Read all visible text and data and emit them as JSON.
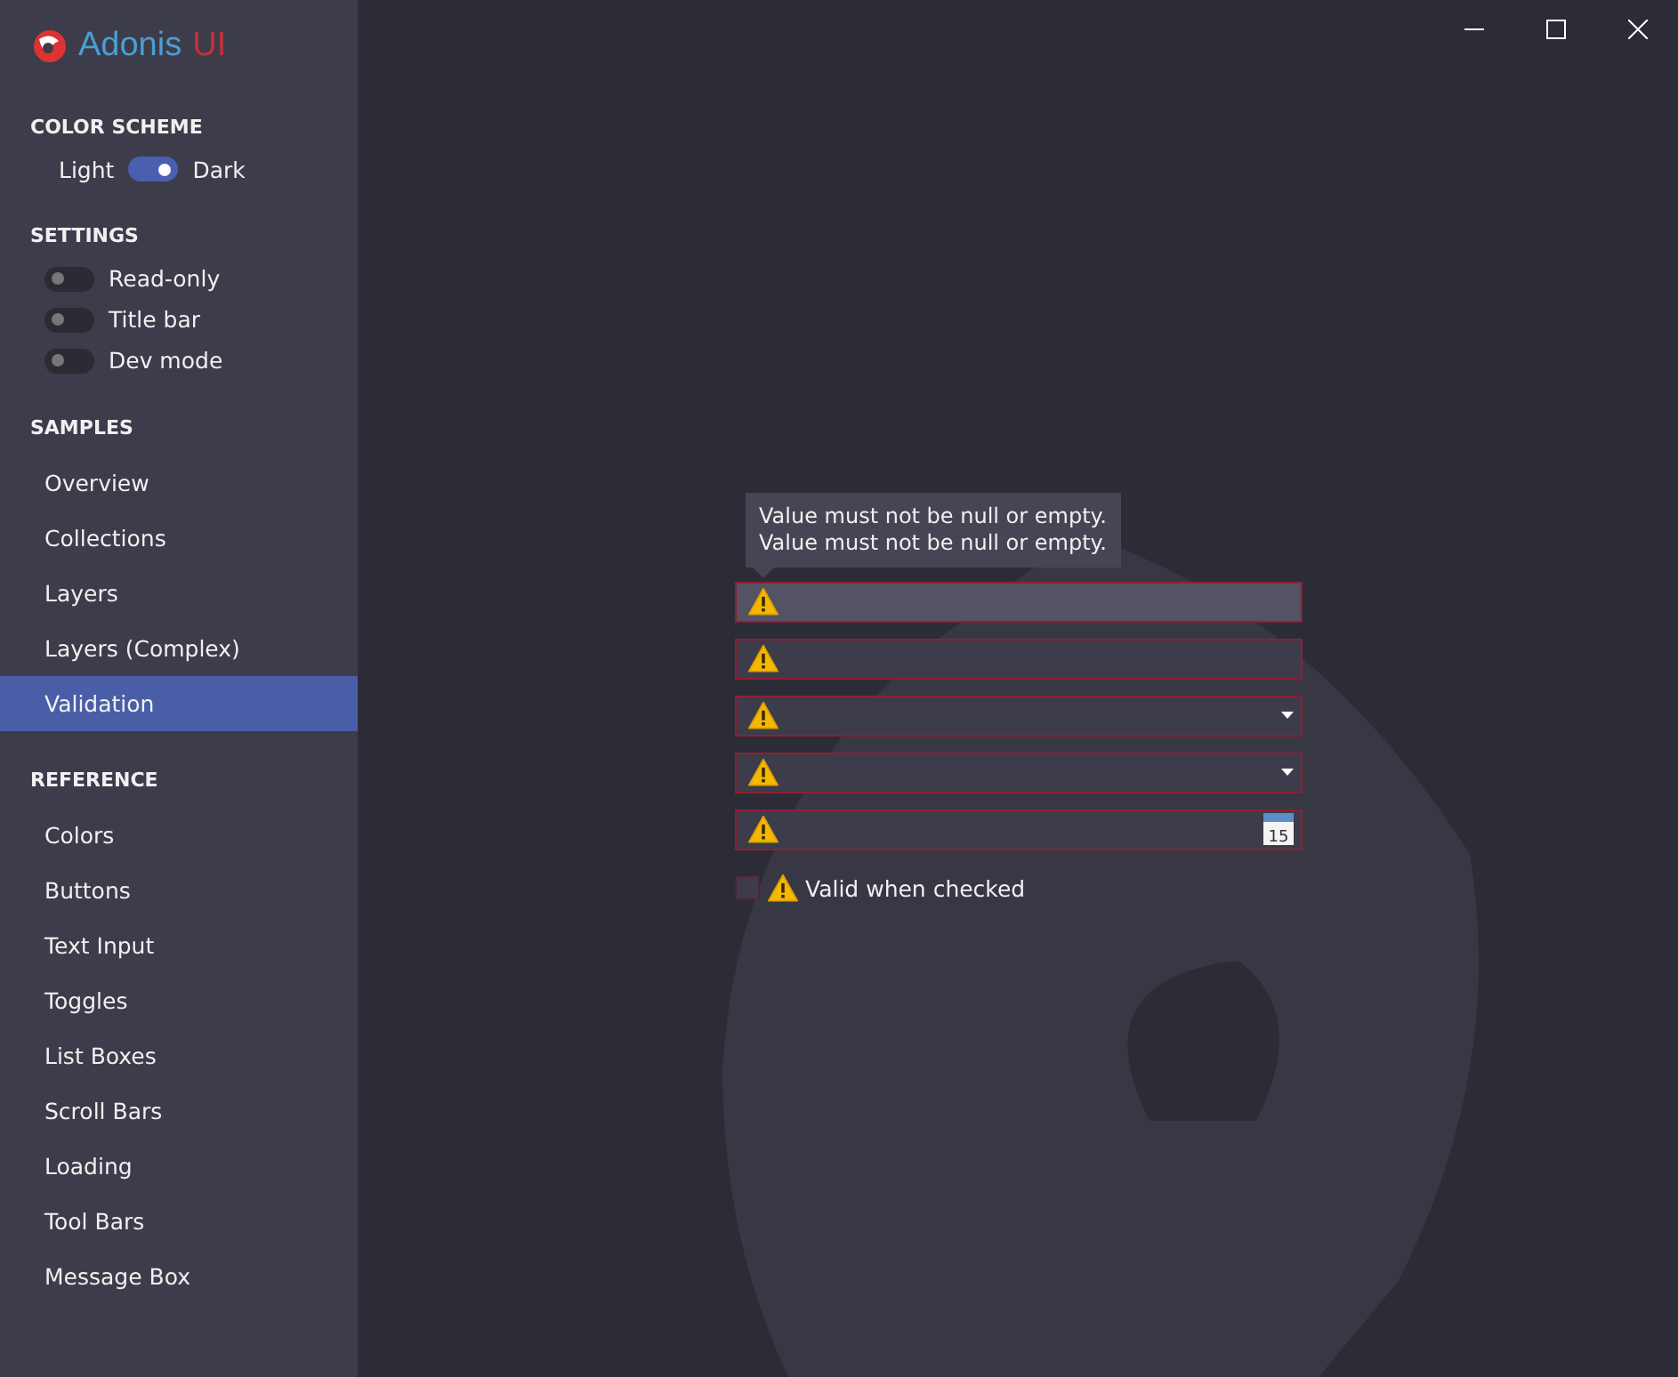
{
  "app": {
    "name": "Adonis",
    "name_accent": "UI"
  },
  "color_scheme": {
    "heading": "COLOR SCHEME",
    "left_label": "Light",
    "right_label": "Dark",
    "on": true
  },
  "settings": {
    "heading": "SETTINGS",
    "toggles": [
      {
        "label": "Read-only",
        "on": false
      },
      {
        "label": "Title bar",
        "on": false
      },
      {
        "label": "Dev mode",
        "on": false
      }
    ]
  },
  "nav_sections": [
    {
      "heading": "SAMPLES",
      "items": [
        {
          "label": "Overview",
          "selected": false
        },
        {
          "label": "Collections",
          "selected": false
        },
        {
          "label": "Layers",
          "selected": false
        },
        {
          "label": "Layers (Complex)",
          "selected": false
        },
        {
          "label": "Validation",
          "selected": true
        }
      ]
    },
    {
      "heading": "REFERENCE",
      "items": [
        {
          "label": "Colors",
          "selected": false
        },
        {
          "label": "Buttons",
          "selected": false
        },
        {
          "label": "Text Input",
          "selected": false
        },
        {
          "label": "Toggles",
          "selected": false
        },
        {
          "label": "List Boxes",
          "selected": false
        },
        {
          "label": "Scroll Bars",
          "selected": false
        },
        {
          "label": "Loading",
          "selected": false
        },
        {
          "label": "Tool Bars",
          "selected": false
        },
        {
          "label": "Message Box",
          "selected": false
        }
      ]
    }
  ],
  "tooltip": {
    "lines": [
      "Value must not be null or empty.",
      "Value must not be null or empty."
    ]
  },
  "fields": [
    {
      "kind": "text",
      "focused": true
    },
    {
      "kind": "text",
      "focused": false
    },
    {
      "kind": "combo",
      "focused": false
    },
    {
      "kind": "combo",
      "focused": false
    },
    {
      "kind": "date",
      "focused": false,
      "calendar_day": "15"
    }
  ],
  "checkbox": {
    "label": "Valid when checked",
    "checked": false
  }
}
